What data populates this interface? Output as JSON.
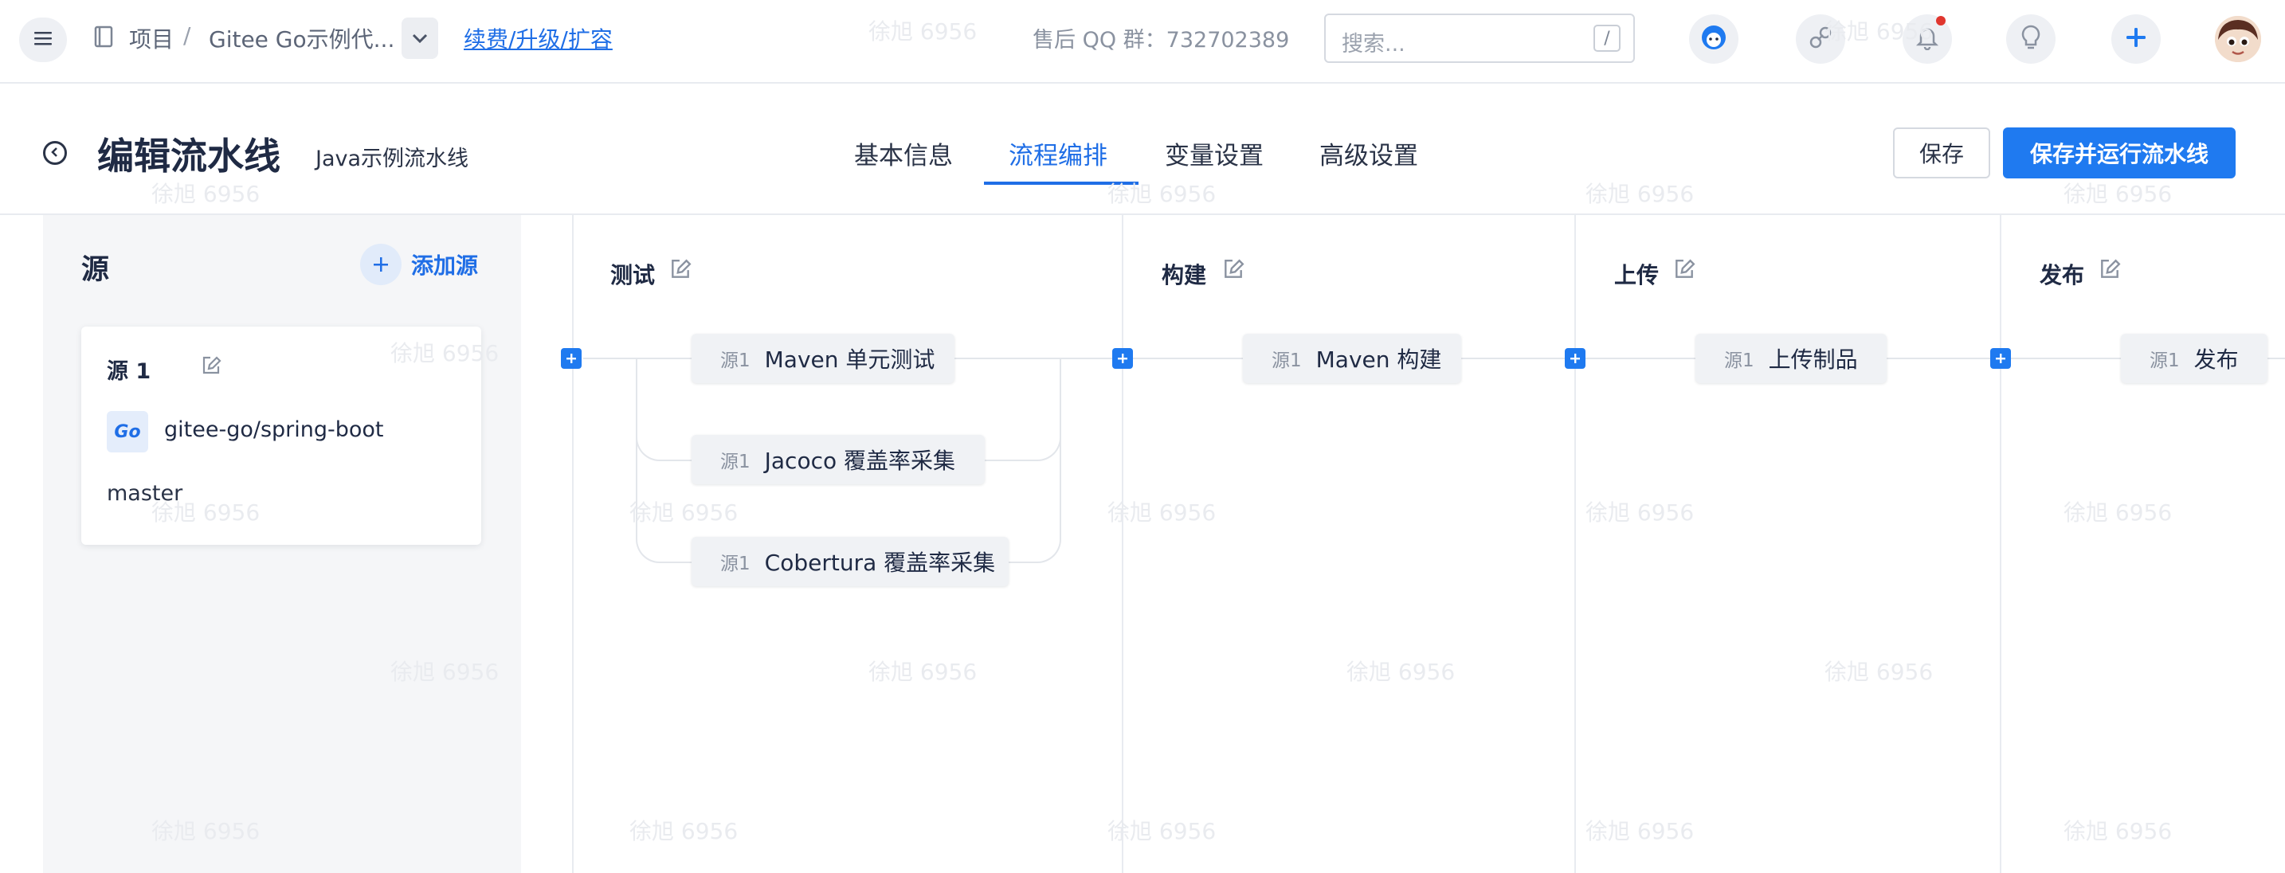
{
  "topbar": {
    "breadcrumb_project": "项目",
    "breadcrumb_separator": "/",
    "breadcrumb_repo": "Gitee Go示例代...",
    "upgrade_link": "续费/升级/扩容",
    "qq_group": "售后 QQ 群：732702389",
    "search_placeholder": "搜索...",
    "search_shortcut": "/"
  },
  "header": {
    "title": "编辑流水线",
    "subtitle": "Java示例流水线",
    "tabs": [
      {
        "label": "基本信息",
        "active": false
      },
      {
        "label": "流程编排",
        "active": true
      },
      {
        "label": "变量设置",
        "active": false
      },
      {
        "label": "高级设置",
        "active": false
      }
    ],
    "save_label": "保存",
    "save_run_label": "保存并运行流水线"
  },
  "sources": {
    "title": "源",
    "add_label": "添加源",
    "card": {
      "name": "源 1",
      "icon_text": "Go",
      "repo": "gitee-go/spring-boot",
      "branch": "master"
    }
  },
  "stages": [
    {
      "title": "测试",
      "jobs": [
        {
          "source": "源1",
          "label": "Maven 单元测试"
        },
        {
          "source": "源1",
          "label": "Jacoco 覆盖率采集"
        },
        {
          "source": "源1",
          "label": "Cobertura 覆盖率采集"
        }
      ]
    },
    {
      "title": "构建",
      "jobs": [
        {
          "source": "源1",
          "label": "Maven 构建"
        }
      ]
    },
    {
      "title": "上传",
      "jobs": [
        {
          "source": "源1",
          "label": "上传制品"
        }
      ]
    },
    {
      "title": "发布",
      "jobs": [
        {
          "source": "源1",
          "label": "发布"
        }
      ]
    }
  ],
  "watermark_text": "徐旭 6956",
  "colors": {
    "accent": "#1f7af0",
    "link": "#1f6ee6",
    "text": "#1f2a44",
    "panel_bg": "#f5f6f8",
    "notification_dot": "#e0362e"
  }
}
